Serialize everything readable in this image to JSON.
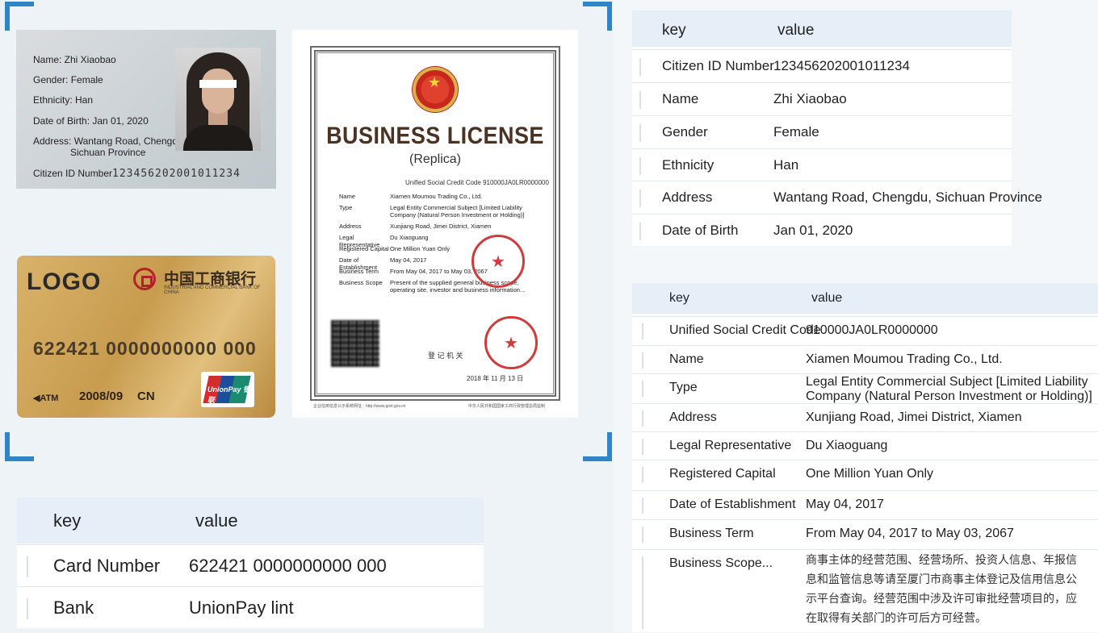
{
  "id_card": {
    "name_line": "Name: Zhi Xiaobao",
    "gender_line": "Gender: Female",
    "ethnicity_line": "Ethnicity: Han",
    "dob_line": "Date of Birth: Jan 01, 2020",
    "address_line1": "Address: Wantang Road, Chengdu,",
    "address_line2": "Sichuan Province",
    "citizen_label": "Citizen ID Number",
    "citizen_number": "123456202001011234"
  },
  "bank_card": {
    "logo": "LOGO",
    "bank_name": "中国工商银行",
    "bank_sub": "INDUSTRIAL AND COMMERCIAL BANK OF CHINA",
    "card_number": "622421  0000000000 000",
    "atm": "◀ATM",
    "expiry": "2008/09",
    "country": "CN",
    "unionpay": "UnionPay 银联"
  },
  "license": {
    "title": "BUSINESS LICENSE",
    "subtitle": "(Replica)",
    "code_label": "Unified Social Credit Code",
    "code_value": "910000JA0LR0000000",
    "rows": [
      {
        "k": "Name",
        "v": "Xiamen Moumou Trading Co., Ltd."
      },
      {
        "k": "Type",
        "v": "Legal Entity Commercial Subject [Limited Liability Company (Natural Person Investment or Holding)]"
      },
      {
        "k": "Address",
        "v": "Xunjiang Road, Jimei District, Xiamen"
      },
      {
        "k": "Legal Representative",
        "v": "Du Xiaoguang"
      },
      {
        "k": "Registered Capital",
        "v": "One Million Yuan Only"
      },
      {
        "k": "Date of Establishment",
        "v": "May 04, 2017"
      },
      {
        "k": "Business Term",
        "v": "From May 04, 2017 to May 03, 2067"
      },
      {
        "k": "Business Scope",
        "v": "Present of the supplied general business scope, operating site, investor and business information..."
      }
    ],
    "issuer": "登 记 机 关",
    "date": "2018  年  11  月  13  日",
    "footer_left": "企业信用信息公示系统网址：http://www.gsxt.gov.cn",
    "footer_right": "中华人民共和国国家工商行政管理总局监制"
  },
  "table_id": {
    "header_key": "key",
    "header_value": "value",
    "rows": [
      {
        "k": "Citizen ID Number",
        "v": "123456202001011234"
      },
      {
        "k": "Name",
        "v": "Zhi Xiaobao"
      },
      {
        "k": "Gender",
        "v": "Female"
      },
      {
        "k": "Ethnicity",
        "v": "Han"
      },
      {
        "k": "Address",
        "v": "Wantang Road, Chengdu, Sichuan Province"
      },
      {
        "k": "Date of Birth",
        "v": "Jan 01, 2020"
      }
    ]
  },
  "table_license": {
    "header_key": "key",
    "header_value": "value",
    "rows": [
      {
        "k": "Unified Social Credit Code",
        "v": "910000JA0LR0000000"
      },
      {
        "k": "Name",
        "v": "Xiamen Moumou Trading Co., Ltd."
      },
      {
        "k": "Type",
        "v": "Legal Entity Commercial Subject [Limited Liability Company (Natural Person Investment or Holding)]"
      },
      {
        "k": "Address",
        "v": "Xunjiang Road, Jimei District, Xiamen"
      },
      {
        "k": "Legal Representative",
        "v": "Du Xiaoguang"
      },
      {
        "k": "Registered Capital",
        "v": "One Million Yuan Only"
      },
      {
        "k": "Date of Establishment",
        "v": "May 04, 2017"
      },
      {
        "k": "Business Term",
        "v": "From May 04, 2017 to May 03, 2067"
      },
      {
        "k": "Business Scope...",
        "v": "商事主体的经营范围、经营场所、投资人信息、年报信息和监管信息等请至厦门市商事主体登记及信用信息公示平台查询。经营范围中涉及许可审批经营项目的，应在取得有关部门的许可后方可经营。"
      }
    ]
  },
  "table_bank": {
    "header_key": "key",
    "header_value": "value",
    "rows": [
      {
        "k": "Card Number",
        "v": "622421 0000000000 000"
      },
      {
        "k": "Bank",
        "v": "UnionPay lint"
      }
    ]
  }
}
